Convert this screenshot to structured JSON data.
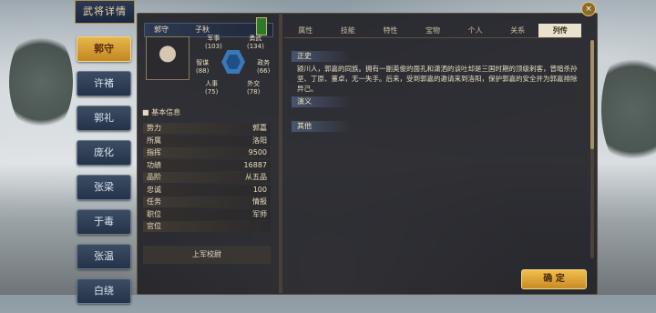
{
  "title": "武将详情",
  "sidebar": [
    "郭守",
    "许褚",
    "郭礼",
    "庞化",
    "张梁",
    "于毒",
    "张温",
    "白绕"
  ],
  "sidebar_active_index": 0,
  "header": {
    "name": "郭守",
    "courtesy": "子秋"
  },
  "stats": {
    "military": {
      "label": "军事",
      "value": "(103)"
    },
    "courage": {
      "label": "勇武",
      "value": "(134)"
    },
    "strategy": {
      "label": "智谋",
      "value": "(88)"
    },
    "politics": {
      "label": "政务",
      "value": "(66)"
    },
    "personnel": {
      "label": "人事",
      "value": "(75)"
    },
    "diplomacy": {
      "label": "外交",
      "value": "(78)"
    }
  },
  "basic_info_title": "基本信息",
  "basic_info": [
    {
      "label": "势力",
      "value": "郭嘉"
    },
    {
      "label": "所属",
      "value": "洛阳"
    },
    {
      "label": "指挥",
      "value": "9500"
    },
    {
      "label": "功绩",
      "value": "16887"
    },
    {
      "label": "品阶",
      "value": "从五品"
    },
    {
      "label": "忠诚",
      "value": "100"
    },
    {
      "label": "任务",
      "value": "情报"
    },
    {
      "label": "职位",
      "value": "军师"
    },
    {
      "label": "官位",
      "value": ""
    }
  ],
  "footer_button": "上军校尉",
  "tabs": [
    "属性",
    "技能",
    "特性",
    "宝物",
    "个人",
    "关系",
    "列传"
  ],
  "active_tab_index": 6,
  "sections": {
    "history": "正史",
    "novel": "演义",
    "other": "其他"
  },
  "bio_text": "颍川人，郭嘉的同族。拥有一副英俊的面孔和潇洒的谈吐却是三国时期的顶级刺客，曾暗杀孙坚、丁原、董卓，无一失手。后来，受到郭嘉的邀请来到洛阳，保护郭嘉的安全并为郭嘉排除异己。",
  "confirm_button": "确 定",
  "colors": {
    "accent": "#c98a24",
    "panel": "#222228",
    "hex": "#3a78b8"
  }
}
